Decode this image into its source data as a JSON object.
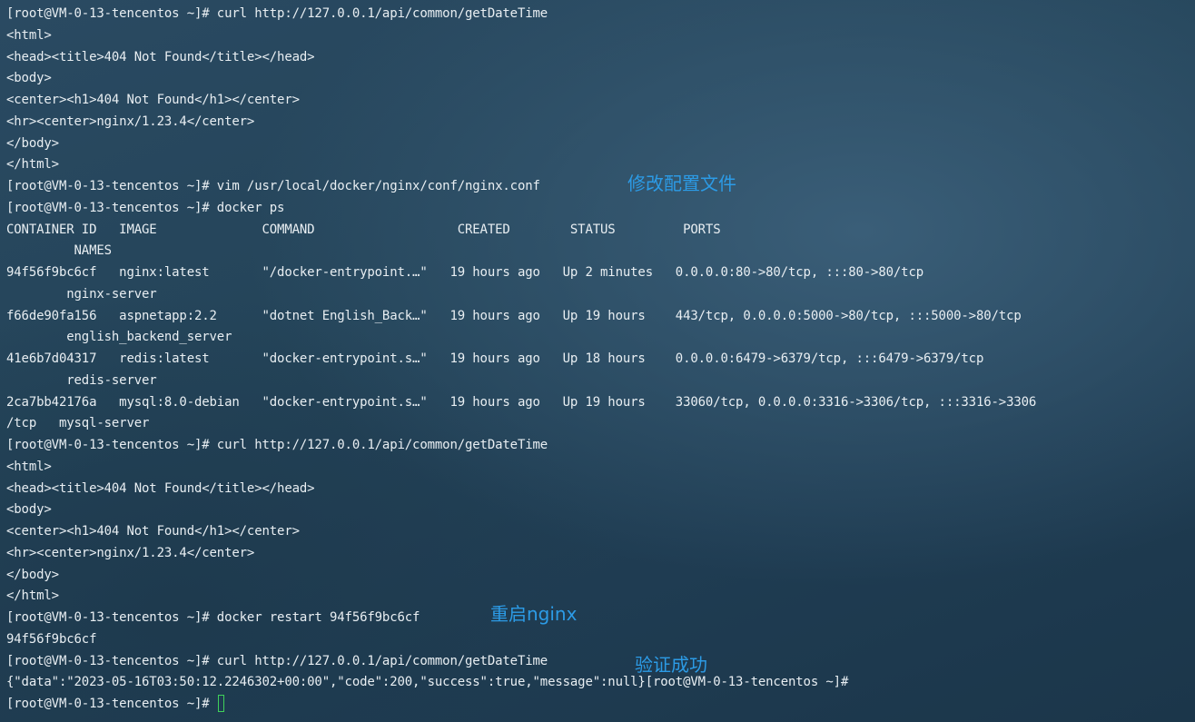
{
  "terminal": {
    "lines": [
      "[root@VM-0-13-tencentos ~]# curl http://127.0.0.1/api/common/getDateTime",
      "<html>",
      "<head><title>404 Not Found</title></head>",
      "<body>",
      "<center><h1>404 Not Found</h1></center>",
      "<hr><center>nginx/1.23.4</center>",
      "</body>",
      "</html>",
      "[root@VM-0-13-tencentos ~]# vim /usr/local/docker/nginx/conf/nginx.conf",
      "[root@VM-0-13-tencentos ~]# docker ps",
      "CONTAINER ID   IMAGE              COMMAND                   CREATED        STATUS         PORTS",
      "         NAMES",
      "94f56f9bc6cf   nginx:latest       \"/docker-entrypoint.…\"   19 hours ago   Up 2 minutes   0.0.0.0:80->80/tcp, :::80->80/tcp",
      "        nginx-server",
      "f66de90fa156   aspnetapp:2.2      \"dotnet English_Back…\"   19 hours ago   Up 19 hours    443/tcp, 0.0.0.0:5000->80/tcp, :::5000->80/tcp",
      "        english_backend_server",
      "41e6b7d04317   redis:latest       \"docker-entrypoint.s…\"   19 hours ago   Up 18 hours    0.0.0.0:6479->6379/tcp, :::6479->6379/tcp",
      "        redis-server",
      "2ca7bb42176a   mysql:8.0-debian   \"docker-entrypoint.s…\"   19 hours ago   Up 19 hours    33060/tcp, 0.0.0.0:3316->3306/tcp, :::3316->3306",
      "/tcp   mysql-server",
      "[root@VM-0-13-tencentos ~]# curl http://127.0.0.1/api/common/getDateTime",
      "<html>",
      "<head><title>404 Not Found</title></head>",
      "<body>",
      "<center><h1>404 Not Found</h1></center>",
      "<hr><center>nginx/1.23.4</center>",
      "</body>",
      "</html>",
      "[root@VM-0-13-tencentos ~]# docker restart 94f56f9bc6cf",
      "94f56f9bc6cf",
      "[root@VM-0-13-tencentos ~]# curl http://127.0.0.1/api/common/getDateTime",
      "{\"data\":\"2023-05-16T03:50:12.2246302+00:00\",\"code\":200,\"success\":true,\"message\":null}[root@VM-0-13-tencentos ~]#",
      "[root@VM-0-13-tencentos ~]# "
    ]
  },
  "annotations": {
    "edit_config": "修改配置文件",
    "restart_nginx": "重启nginx",
    "verify_success": "验证成功"
  },
  "colors": {
    "text": "#e8eef2",
    "annotation": "#2c9be6",
    "cursor": "#3fd25a"
  }
}
